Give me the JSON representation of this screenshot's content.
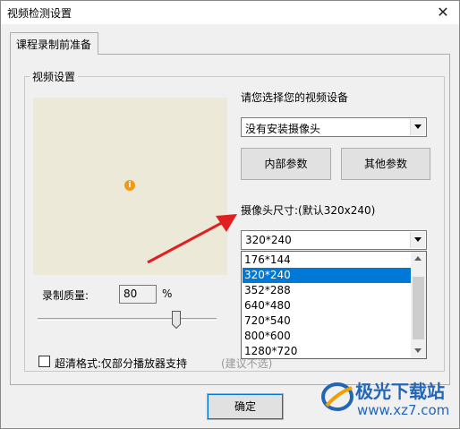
{
  "window": {
    "title": "视频检测设置",
    "close_icon": "close-icon"
  },
  "tabs": [
    {
      "label": "课程录制前准备"
    }
  ],
  "video_group": {
    "label": "视频设置",
    "device_prompt": "请您选择您的视频设备",
    "device_select": {
      "value": "没有安装摄像头"
    },
    "internal_params_button": "内部参数",
    "other_params_button": "其他参数",
    "camera_size_label": "摄像头尺寸:(默认320x240)",
    "size_select": {
      "value": "320*240",
      "options": [
        "176*144",
        "320*240",
        "352*288",
        "640*480",
        "720*540",
        "800*600",
        "1280*720"
      ],
      "selected_index": 1
    },
    "quality_label": "录制质量:",
    "quality_value": "80",
    "quality_unit": "%",
    "hd_checkbox_label": "超清格式:仅部分播放器支持",
    "hd_hint": "(建议不选)"
  },
  "ok_button": "确定",
  "watermark": {
    "brand": "极光下载站",
    "url": "www.xz7.com"
  },
  "colors": {
    "selection": "#0078d7",
    "annotation_arrow": "#e02020",
    "preview_bg": "#ece9d8"
  }
}
